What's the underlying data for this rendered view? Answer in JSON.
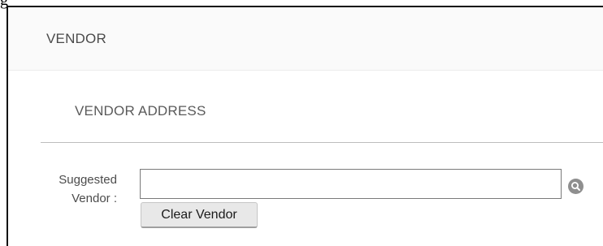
{
  "top_fragment": "g",
  "header": {
    "title": "VENDOR"
  },
  "section": {
    "title": "VENDOR ADDRESS"
  },
  "suggested_vendor": {
    "label_line1": "Suggested",
    "label_line2": "Vendor :",
    "input_value": "",
    "search_icon": "magnifier-icon",
    "clear_button_label": "Clear Vendor"
  },
  "colors": {
    "header_bg": "#fafafa",
    "text": "#4a4a4a",
    "divider": "#bdbdbd",
    "search_icon_bg": "#8f8f8f",
    "button_bg": "#e8e8e8"
  }
}
